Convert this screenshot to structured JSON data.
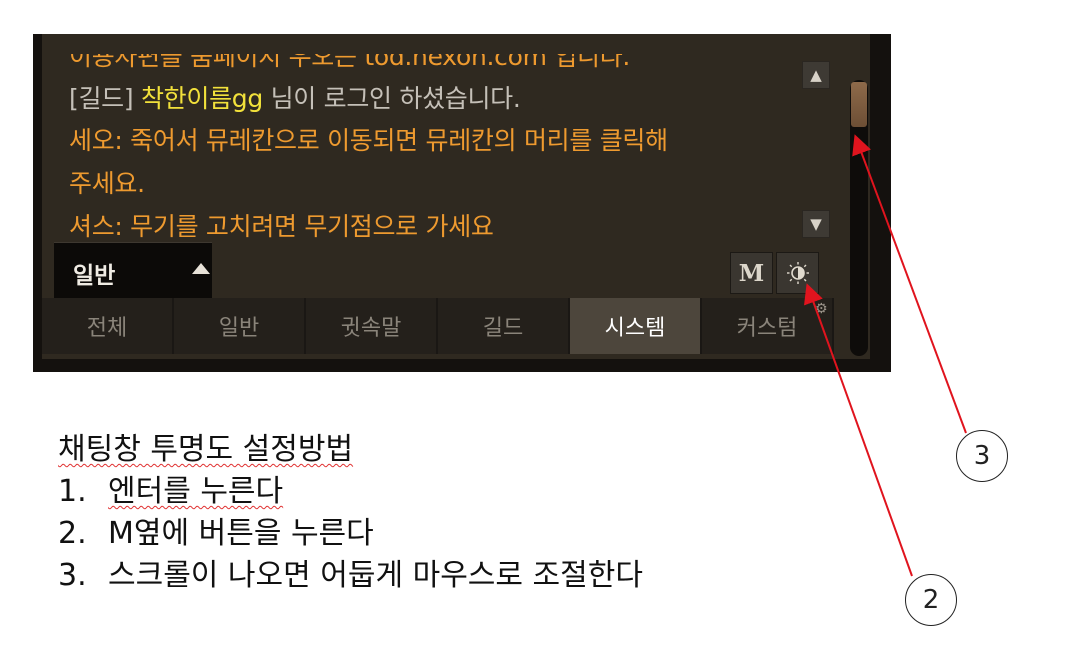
{
  "chat": {
    "lines": {
      "cut_top": "이용자편을 움페이지 우오는 tod.nexon.com 입니다.",
      "guild_prefix": "[길드] ",
      "guild_name": "착한이름gg",
      "guild_suffix": " 님이 로그인 하셨습니다.",
      "line3": "세오: 죽어서 뮤레칸으로 이동되면 뮤레칸의 머리를 클릭해",
      "line4": "주세요.",
      "line5": "셔스: 무기를 고치려면 무기점으로 가세요"
    },
    "scroll_up_icon": "triangle-up",
    "scroll_down_icon": "triangle-down",
    "channel_selector": {
      "label": "일반",
      "icon": "caret-up"
    },
    "buttons": {
      "m_label": "M",
      "opacity_icon": "opacity-icon"
    },
    "tabs": [
      "전체",
      "일반",
      "귓속말",
      "길드",
      "시스템",
      "커스텀"
    ],
    "active_tab": "시스템",
    "colors": {
      "background": "#2f2920",
      "system_text": "#ee9a2f",
      "guild_text": "#c5c0b8",
      "guild_name": "#f2e13b",
      "scroll_thumb": "#8e6a4a"
    }
  },
  "instructions": {
    "title": "채팅창 투명도 설정방법",
    "steps": [
      {
        "num": "1.",
        "text": "엔터를 누른다"
      },
      {
        "num": "2.",
        "text": "M옆에 버튼을 누른다"
      },
      {
        "num": "3.",
        "text": "스크롤이 나오면 어둡게 마우스로 조절한다"
      }
    ]
  },
  "callouts": {
    "scrollbar": "3",
    "opacity_button": "2",
    "arrow_color": "#e0141e"
  }
}
